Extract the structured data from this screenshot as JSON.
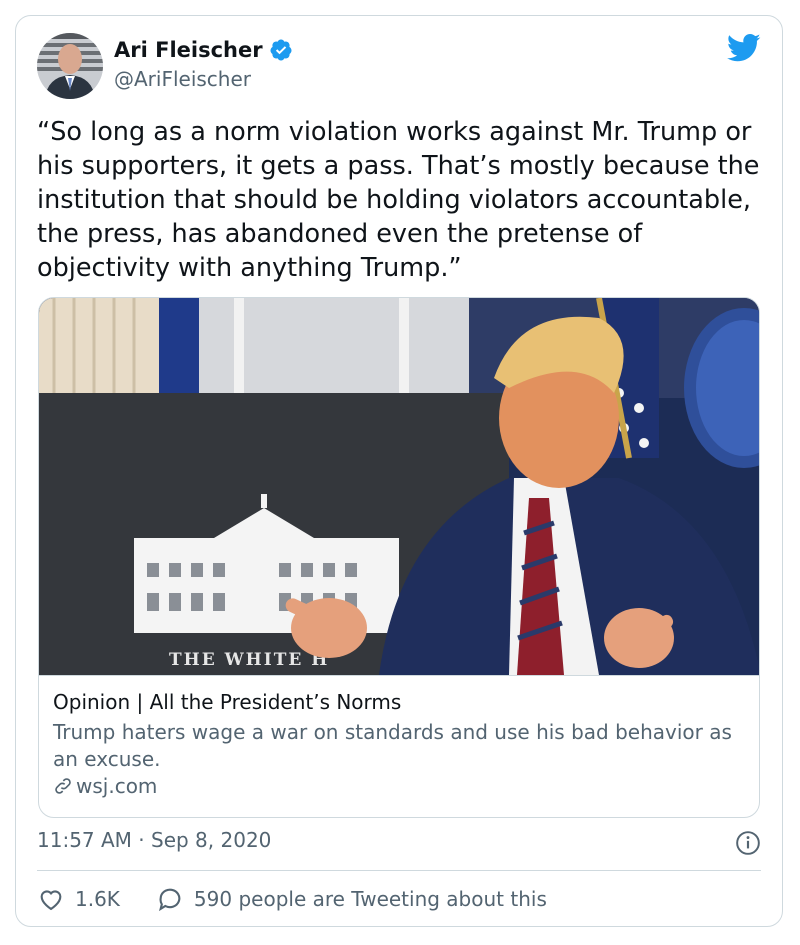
{
  "author": {
    "name": "Ari Fleischer",
    "handle": "@AriFleischer"
  },
  "tweet": {
    "text": "“So long as a norm violation works against Mr. Trump or his supporters, it gets a pass. That’s mostly because the institution that should be holding violators accountable, the press, has abandoned even the pretense of objectivity with anything Trump.”"
  },
  "link_card": {
    "photo_sign_text": "THE WHITE H",
    "title": "Opinion | All the President’s Norms",
    "description": "Trump haters wage a war on standards and use his bad behavior as an excuse.",
    "domain": "wsj.com"
  },
  "timestamp": "11:57 AM · Sep 8, 2020",
  "actions": {
    "likes": "1.6K",
    "conversation": "590 people are Tweeting about this"
  },
  "icons": {
    "verified": "verified-badge-icon",
    "bird": "twitter-bird-icon",
    "info": "info-icon",
    "link": "link-icon",
    "heart": "heart-icon",
    "reply": "speech-bubble-icon"
  },
  "colors": {
    "brand_blue": "#1d9bf0",
    "text": "#0f1419",
    "secondary": "#536471",
    "border": "#cfd9de"
  }
}
